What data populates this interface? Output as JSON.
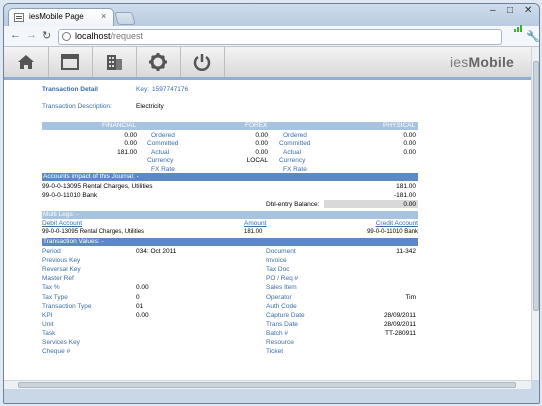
{
  "browser": {
    "tab_title": "iesMobile Page",
    "tab_close": "×",
    "url_host": "localhost",
    "url_path": "/request",
    "window_controls": {
      "minimize": "–",
      "maximize": "□",
      "close": "✕"
    }
  },
  "app": {
    "brand_prefix": "ies",
    "brand_suffix": "Mobile",
    "nav_icons": [
      "home-icon",
      "window-icon",
      "building-icon",
      "gear-icon",
      "power-icon"
    ]
  },
  "transaction": {
    "detail_label": "Transaction Detail",
    "key_label": "Key:",
    "key_value": "1597747176",
    "description_label": "Transaction Description:",
    "description_value": "Electricity"
  },
  "financial_table": {
    "headers": {
      "financial": "FINANCIAL",
      "forex": "FOREX",
      "physical": "PHYSICAL"
    },
    "rows": [
      {
        "fin": "0.00",
        "label1": "Ordered",
        "forex": "0.00",
        "label2": "Ordered",
        "phys": "0.00"
      },
      {
        "fin": "0.00",
        "label1": "Committed",
        "forex": "0.00",
        "label2": "Committed",
        "phys": "0.00"
      },
      {
        "fin": "181.00",
        "label1": "Actual",
        "forex": "0.00",
        "label2": "Actual",
        "phys": "0.00"
      },
      {
        "fin": "",
        "label1": "Currency",
        "forex": "LOCAL",
        "label2": "Currency",
        "phys": ""
      },
      {
        "fin": "",
        "label1": "FX Rate",
        "forex": "",
        "label2": "FX Rate",
        "phys": ""
      }
    ]
  },
  "journal": {
    "header": "Accounts impact of this Journal: -",
    "rows": [
      {
        "account": "99-0-0-13095 Rental Charges, Utilities",
        "amount": "181.00"
      },
      {
        "account": "99-0-0-11010 Bank",
        "amount": "-181.00"
      }
    ],
    "balance_label": "Dbl-entry Balance:",
    "balance_value": "0.00"
  },
  "multi_legs": {
    "header": "Multi Legs: -",
    "col_debit": "Debit Account",
    "col_amount": "Amount",
    "col_credit": "Credit Account",
    "row": {
      "debit": "99-0-0-13095 Rental Charges, Utilities",
      "amount": "181.00",
      "credit": "99-0-0-11010 Bank"
    }
  },
  "values": {
    "header": "Transaction Values: -",
    "left": [
      {
        "label": "Period",
        "value": "034: Oct 2011"
      },
      {
        "label": "Previous Key",
        "value": ""
      },
      {
        "label": "Reversal Key",
        "value": ""
      },
      {
        "label": "Master Ref",
        "value": ""
      },
      {
        "label": "Tax %",
        "value": "0.00"
      },
      {
        "label": "Tax Type",
        "value": "0"
      },
      {
        "label": "Transaction Type",
        "value": "01"
      },
      {
        "label": "KPI",
        "value": "0.00"
      },
      {
        "label": "Unit",
        "value": ""
      },
      {
        "label": "Task",
        "value": ""
      },
      {
        "label": "Services Key",
        "value": ""
      },
      {
        "label": "Cheque #",
        "value": ""
      }
    ],
    "right": [
      {
        "label": "Document",
        "value": "11-342"
      },
      {
        "label": "Invoice",
        "value": ""
      },
      {
        "label": "Tax Doc",
        "value": ""
      },
      {
        "label": "PO / Req #",
        "value": ""
      },
      {
        "label": "Sales Item",
        "value": ""
      },
      {
        "label": "Operator",
        "value": "Tim"
      },
      {
        "label": "Auth Code",
        "value": ""
      },
      {
        "label": "Capture Date",
        "value": "28/09/2011"
      },
      {
        "label": "Trans Date",
        "value": "28/09/2011"
      },
      {
        "label": "Batch #",
        "value": "TT-280911"
      },
      {
        "label": "Resource",
        "value": ""
      },
      {
        "label": "Ticket",
        "value": ""
      }
    ]
  }
}
